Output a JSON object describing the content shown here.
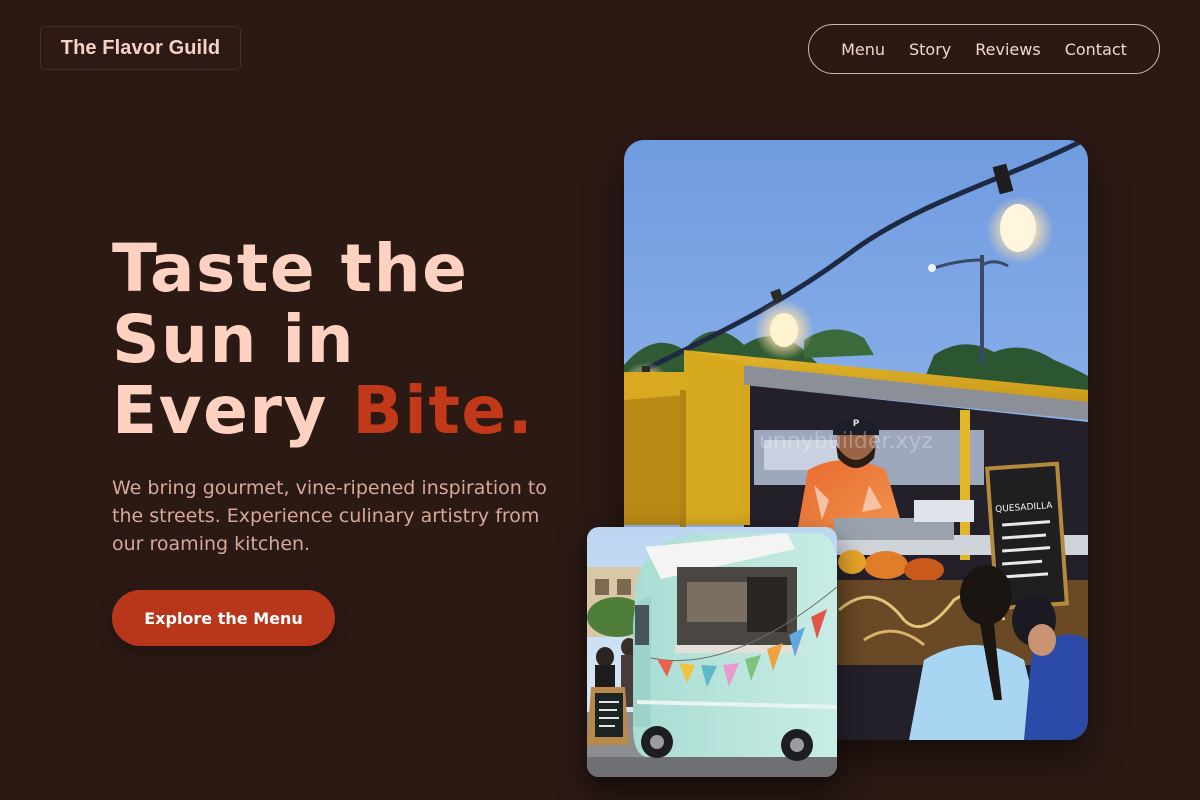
{
  "brand": {
    "name": "The Flavor Guild"
  },
  "nav": {
    "items": [
      "Menu",
      "Story",
      "Reviews",
      "Contact"
    ]
  },
  "hero": {
    "headline_line1": "Taste the",
    "headline_line2": "Sun in",
    "headline_line3_plain": "Every ",
    "headline_line3_accent": "Bite.",
    "description": "We bring gourmet, vine-ripened inspiration to the streets. Experience culinary artistry from our roaming kitchen.",
    "cta_label": "Explore the Menu"
  },
  "images": {
    "main_photo": "food-truck-chef-photo",
    "secondary_photo": "vintage-van-food-truck-photo",
    "main_photo_watermark": "unnybuilder.xyz",
    "truck_sign_text": "QUESADILLA"
  },
  "colors": {
    "background": "#2b1914",
    "accent": "#c2391a",
    "headline": "#ffd1c1",
    "body_text": "#d6a899",
    "cta_background": "#b8361a"
  }
}
